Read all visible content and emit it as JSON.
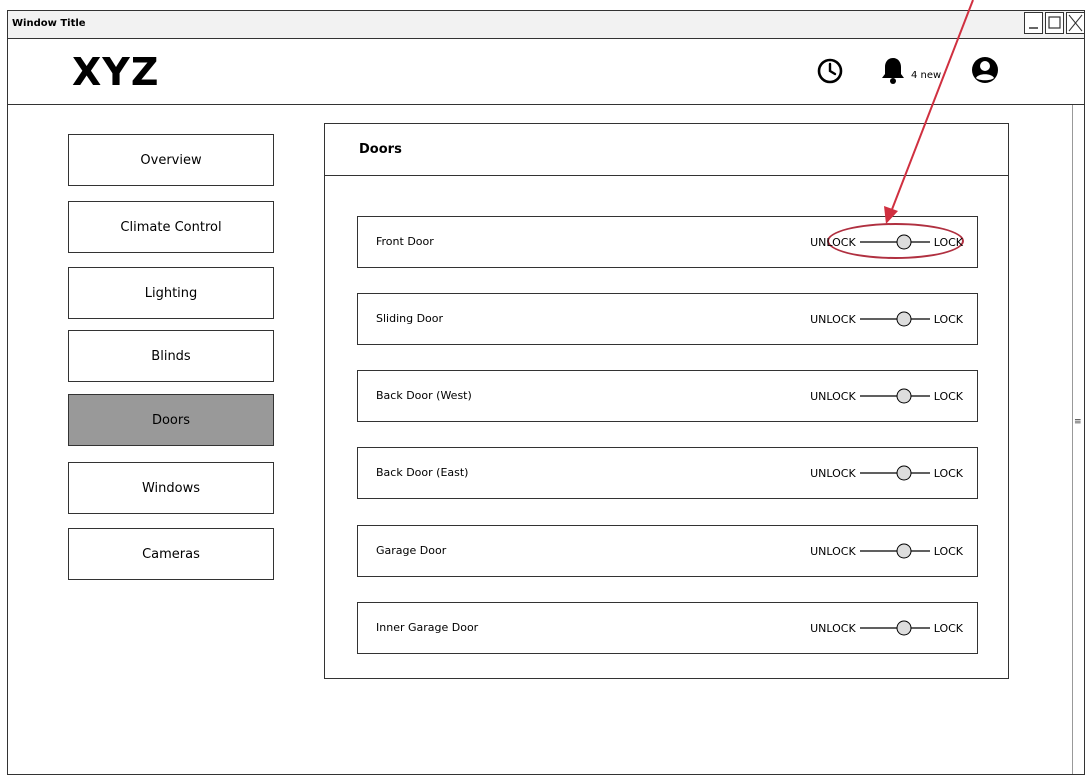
{
  "window": {
    "title": "Window Title"
  },
  "header": {
    "logo": "XYZ",
    "notifications_label": "4 new"
  },
  "sidebar": {
    "items": [
      {
        "label": "Overview"
      },
      {
        "label": "Climate Control"
      },
      {
        "label": "Lighting"
      },
      {
        "label": "Blinds"
      },
      {
        "label": "Doors",
        "active": true
      },
      {
        "label": "Windows"
      },
      {
        "label": "Cameras"
      }
    ]
  },
  "main": {
    "title": "Doors",
    "doors": [
      {
        "name": "Front Door",
        "unlock_label": "UNLOCK",
        "lock_label": "LOCK"
      },
      {
        "name": "Sliding Door",
        "unlock_label": "UNLOCK",
        "lock_label": "LOCK"
      },
      {
        "name": "Back Door (West)",
        "unlock_label": "UNLOCK",
        "lock_label": "LOCK"
      },
      {
        "name": "Back Door (East)",
        "unlock_label": "UNLOCK",
        "lock_label": "LOCK"
      },
      {
        "name": "Garage Door",
        "unlock_label": "UNLOCK",
        "lock_label": "LOCK"
      },
      {
        "name": "Inner Garage Door",
        "unlock_label": "UNLOCK",
        "lock_label": "LOCK"
      }
    ]
  },
  "colors": {
    "active_nav": "#999999",
    "annotation": "#d03040"
  },
  "icons": [
    "clock-icon",
    "bell-icon",
    "user-icon",
    "minimize-icon",
    "maximize-icon",
    "close-icon"
  ]
}
